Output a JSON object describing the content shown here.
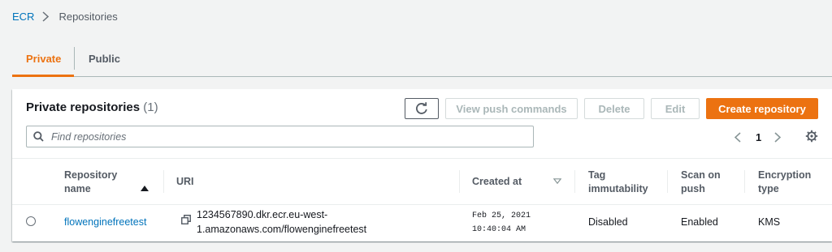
{
  "breadcrumb": {
    "root": "ECR",
    "current": "Repositories"
  },
  "tabs": [
    {
      "label": "Private",
      "active": true
    },
    {
      "label": "Public",
      "active": false
    }
  ],
  "panel": {
    "title": "Private repositories",
    "count": "(1)",
    "buttons": {
      "view_push": "View push commands",
      "delete": "Delete",
      "edit": "Edit",
      "create": "Create repository"
    },
    "search_placeholder": "Find repositories",
    "page": "1"
  },
  "table": {
    "headers": {
      "name_l1": "Repository",
      "name_l2": "name",
      "uri": "URI",
      "created": "Created at",
      "tag_l1": "Tag",
      "tag_l2": "immutability",
      "scan_l1": "Scan on",
      "scan_l2": "push",
      "enc_l1": "Encryption",
      "enc_l2": "type"
    },
    "rows": [
      {
        "name": "flowenginefreetest",
        "uri_l1": "1234567890.dkr.ecr.eu-west-",
        "uri_l2": "1.amazonaws.com/flowenginefreetest",
        "created_l1": "Feb 25, 2021",
        "created_l2": "10:40:04 AM",
        "tag_immutability": "Disabled",
        "scan_on_push": "Enabled",
        "encryption": "KMS"
      }
    ]
  },
  "colors": {
    "accent": "#ec7211",
    "link": "#0073bb",
    "text": "#16191f",
    "muted": "#545b64",
    "disabled": "#aab7b8"
  },
  "icons": [
    "chevron-right-icon",
    "refresh-icon",
    "search-icon",
    "chevron-left-icon",
    "gear-icon",
    "sort-ascending-icon",
    "sort-descending-icon",
    "copy-icon"
  ]
}
